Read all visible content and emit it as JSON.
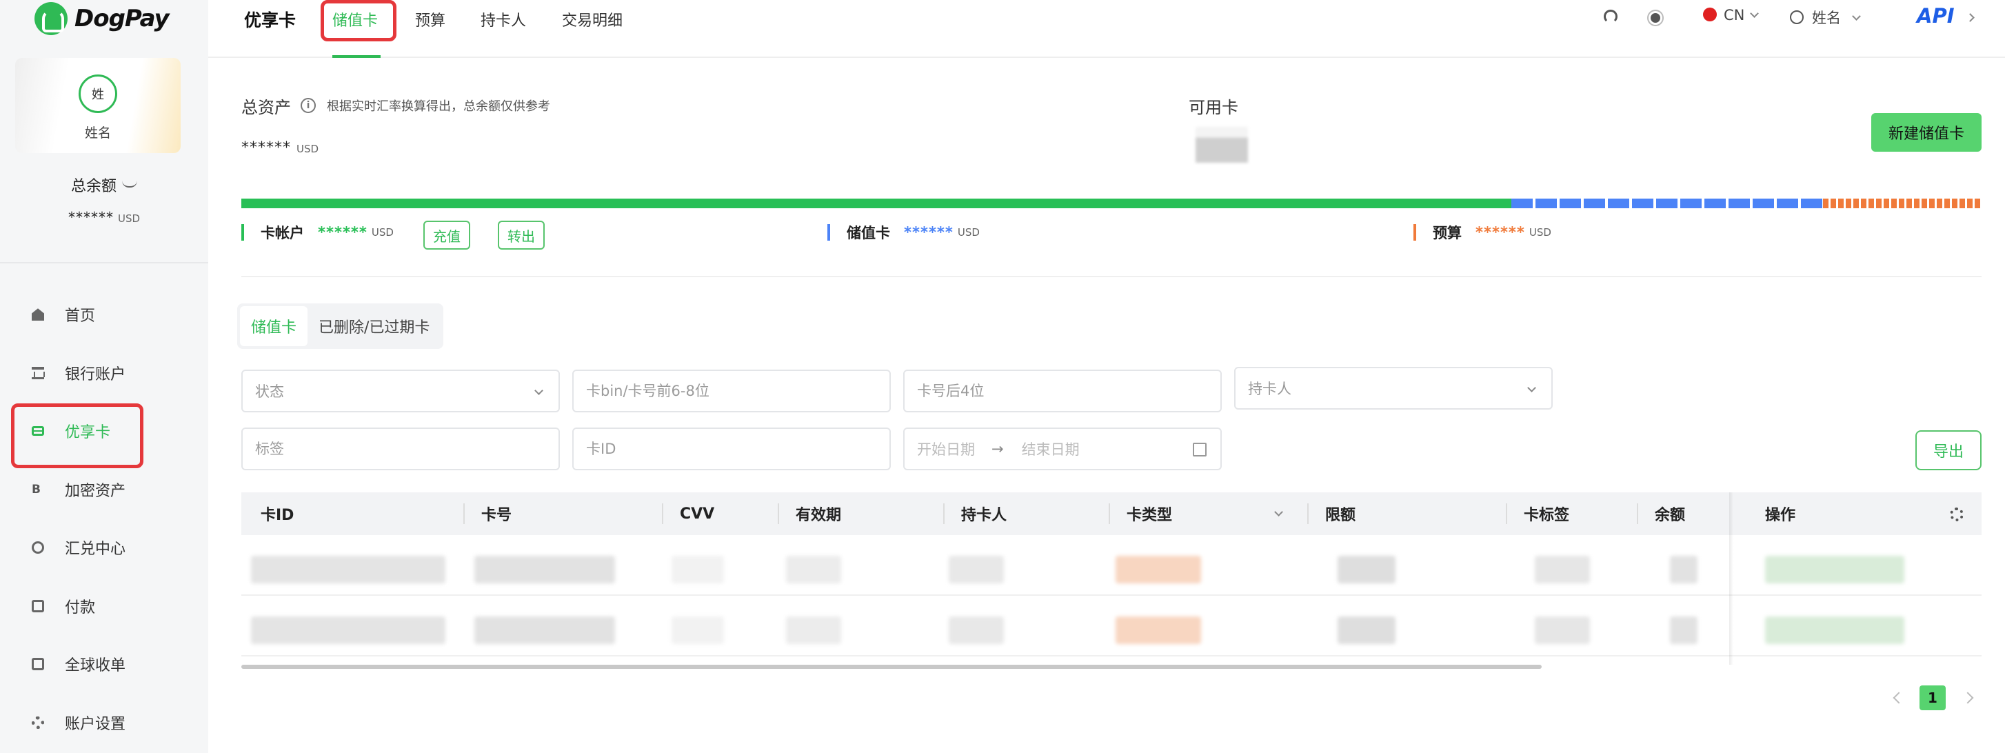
{
  "brand": {
    "name": "DogPay"
  },
  "user": {
    "avatar_text": "姓",
    "name": "姓名"
  },
  "sidebar": {
    "balance_title": "总余额",
    "balance_value": "******",
    "balance_unit": "USD",
    "items": [
      {
        "label": "首页",
        "icon": "home-icon"
      },
      {
        "label": "银行账户",
        "icon": "bank-icon"
      },
      {
        "label": "优享卡",
        "icon": "card-icon",
        "active": true
      },
      {
        "label": "加密资产",
        "icon": "crypto-icon"
      },
      {
        "label": "汇兑中心",
        "icon": "exchange-icon"
      },
      {
        "label": "付款",
        "icon": "wallet-icon"
      },
      {
        "label": "全球收单",
        "icon": "collect-icon"
      },
      {
        "label": "账户设置",
        "icon": "settings-icon"
      }
    ]
  },
  "header": {
    "title": "优享卡",
    "tabs": [
      {
        "label": "储值卡",
        "active": true
      },
      {
        "label": "预算"
      },
      {
        "label": "持卡人"
      },
      {
        "label": "交易明细"
      }
    ],
    "language": "CN",
    "user_name": "姓名",
    "api_label": "API"
  },
  "assets": {
    "title": "总资产",
    "note": "根据实时汇率换算得出，总余额仅供参考",
    "value": "******",
    "unit": "USD",
    "available_title": "可用卡",
    "new_card_button": "新建储值卡",
    "breakdown": [
      {
        "label": "卡帐户",
        "value": "******",
        "unit": "USD",
        "color": "#28bf56"
      },
      {
        "label": "储值卡",
        "value": "******",
        "unit": "USD",
        "color": "#4c83f7"
      },
      {
        "label": "预算",
        "value": "******",
        "unit": "USD",
        "color": "#f07a3a"
      }
    ],
    "recharge_button": "充值",
    "transfer_button": "转出"
  },
  "subtabs": [
    {
      "label": "储值卡",
      "active": true
    },
    {
      "label": "已删除/已过期卡"
    }
  ],
  "filters": {
    "status_placeholder": "状态",
    "bin_placeholder": "卡bin/卡号前6-8位",
    "last4_placeholder": "卡号后4位",
    "cardholder_placeholder": "持卡人",
    "tag_placeholder": "标签",
    "card_id_placeholder": "卡ID",
    "start_date_placeholder": "开始日期",
    "end_date_placeholder": "结束日期",
    "export_button": "导出"
  },
  "table": {
    "columns": [
      "卡ID",
      "卡号",
      "CVV",
      "有效期",
      "持卡人",
      "卡类型",
      "限额",
      "卡标签",
      "余额",
      "操作"
    ]
  },
  "pagination": {
    "current": "1"
  }
}
